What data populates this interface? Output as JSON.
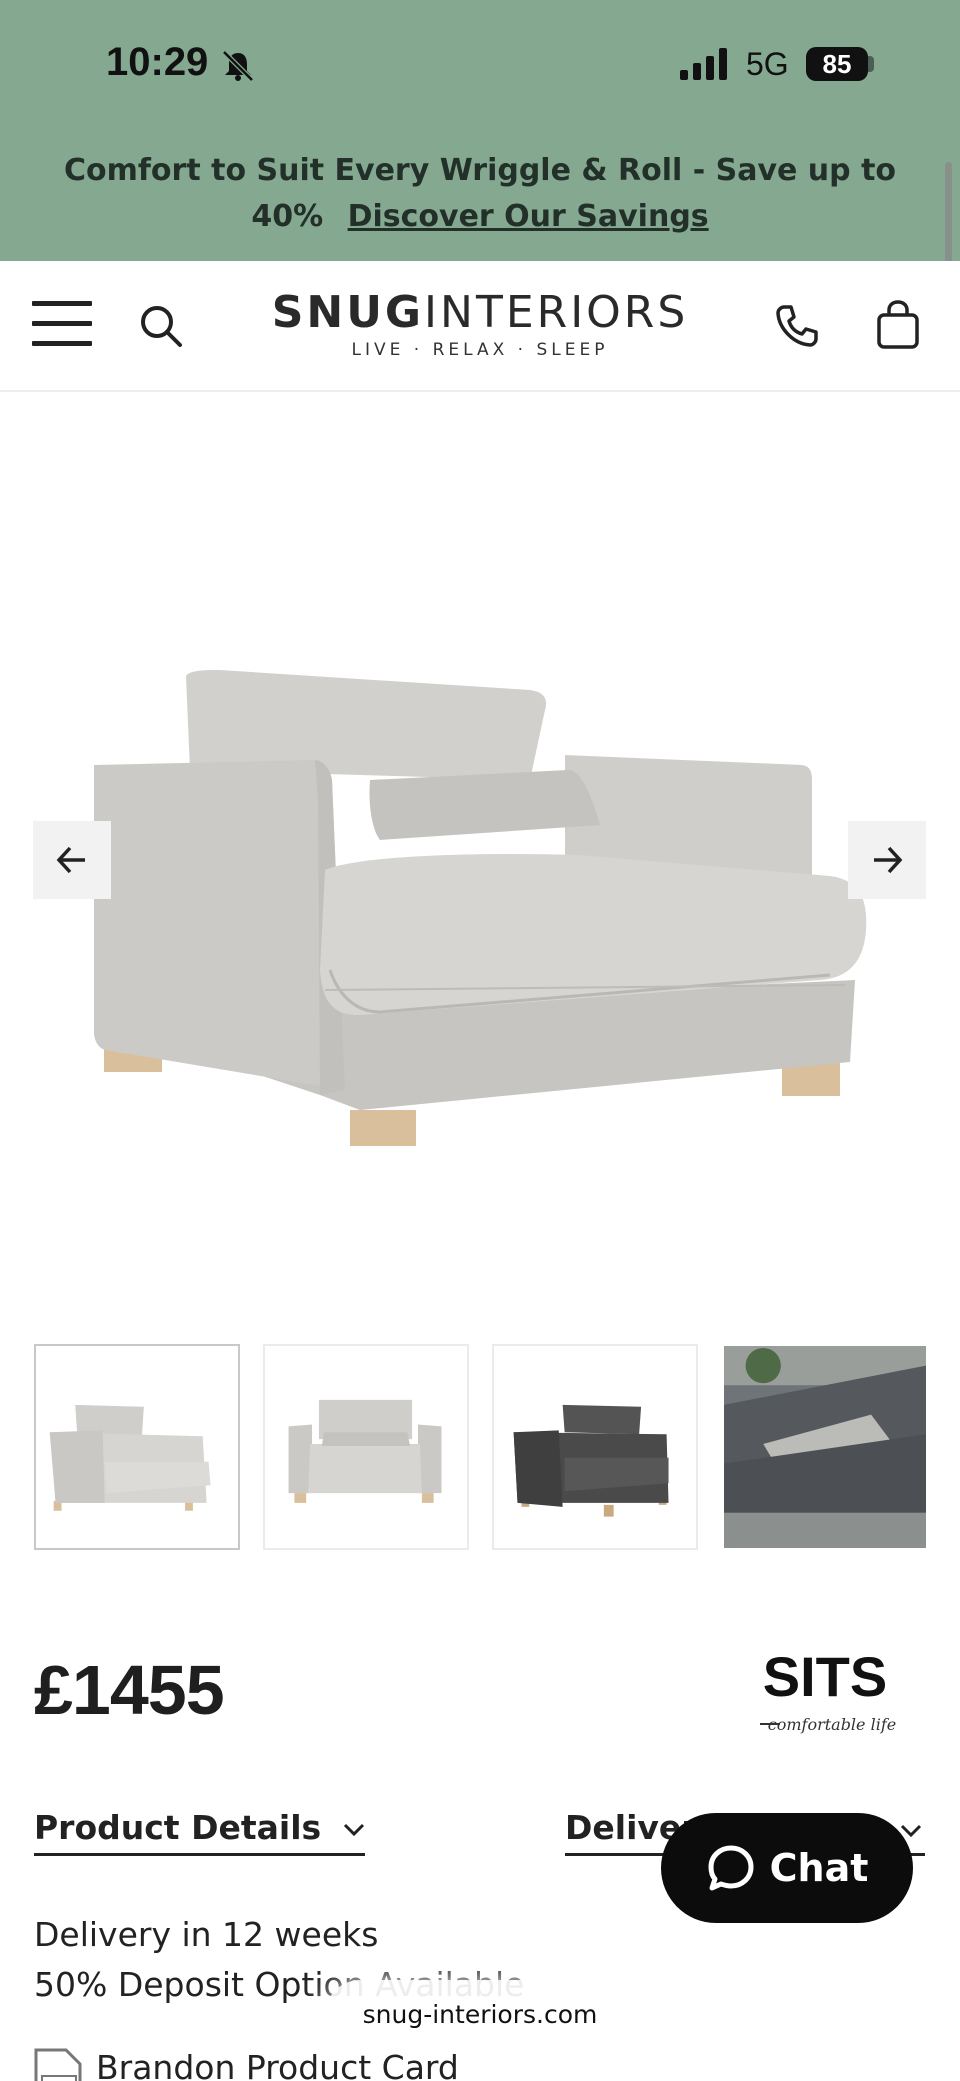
{
  "status_bar": {
    "time": "10:29",
    "network": "5G",
    "battery": "85"
  },
  "promo": {
    "text": "Comfort to Suit Every Wriggle & Roll - Save up to 40%",
    "link": "Discover Our Savings"
  },
  "header": {
    "logo_bold": "SNUG",
    "logo_light": "INTERIORS",
    "tagline": "LIVE · RELAX · SLEEP"
  },
  "product": {
    "price": "£1455",
    "brand_logo_text": "SITS",
    "brand_logo_sub": "comfortable life",
    "thumbnails": [
      "thumb-light-grey-angle",
      "thumb-light-grey-front",
      "thumb-dark-grey",
      "thumb-lifestyle-dark"
    ]
  },
  "tabs": {
    "details": "Product Details",
    "delivery": "Delivery"
  },
  "chat": {
    "label": "Chat"
  },
  "info": {
    "delivery_time": "Delivery in 12 weeks",
    "deposit": "50% Deposit Option Available",
    "pdf_label": "Brandon Product Card"
  },
  "browser": {
    "url": "snug-interiors.com"
  },
  "colors": {
    "promo_bg": "#84a890",
    "text_dark": "#1f1f1f",
    "chat_bg": "#0c0c0c"
  }
}
